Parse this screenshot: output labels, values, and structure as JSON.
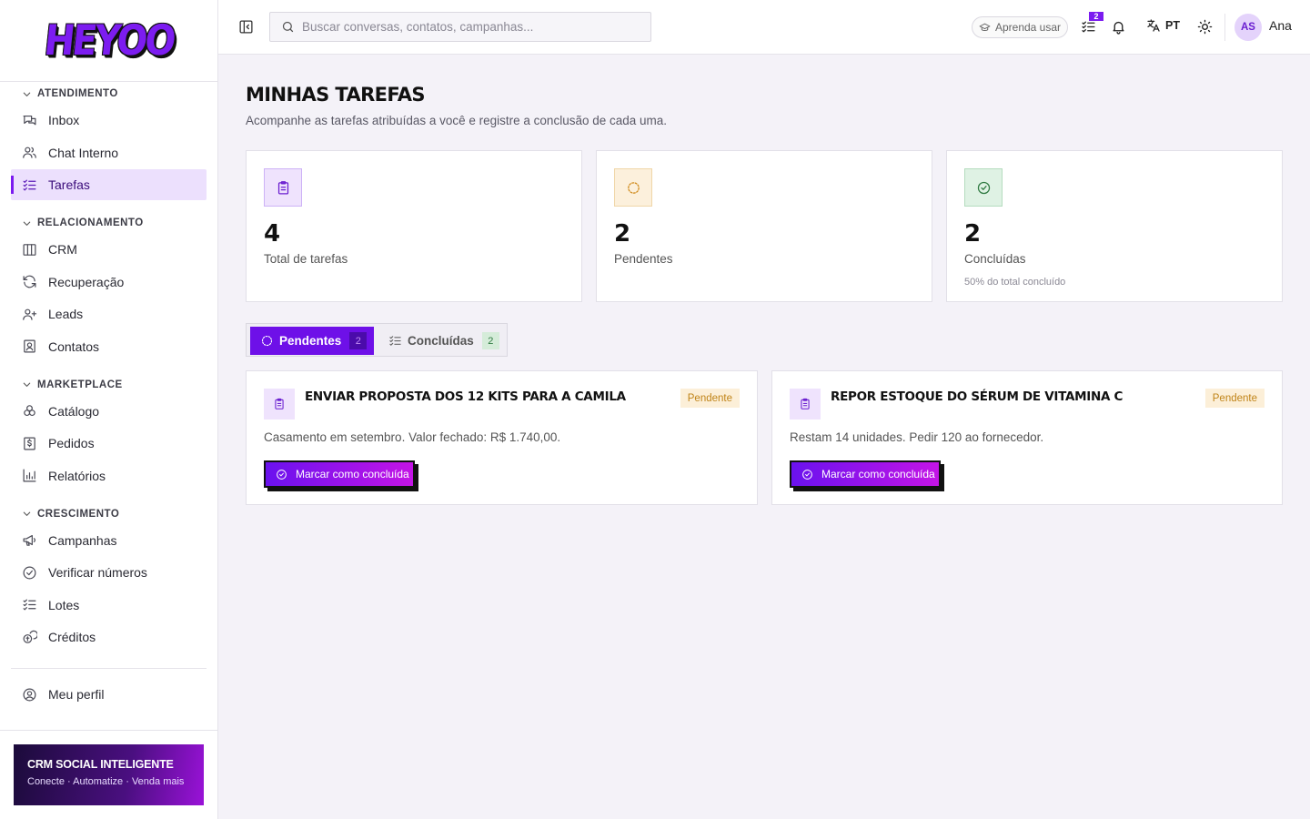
{
  "app": {
    "logo_text": "HEYOO",
    "colors": {
      "accent": "#6e10e8",
      "accent_soft": "#ece0fd",
      "pending": "#c08418",
      "done": "#2f7a41"
    }
  },
  "sidebar": {
    "sections": [
      {
        "title": "ATENDIMENTO",
        "items": [
          {
            "label": "Inbox",
            "icon": "inbox-icon"
          },
          {
            "label": "Chat Interno",
            "icon": "users-icon"
          },
          {
            "label": "Tarefas",
            "icon": "list-check-icon",
            "active": true
          }
        ]
      },
      {
        "title": "RELACIONAMENTO",
        "items": [
          {
            "label": "CRM",
            "icon": "columns-icon"
          },
          {
            "label": "Recuperação",
            "icon": "refresh-icon"
          },
          {
            "label": "Leads",
            "icon": "user-plus-icon"
          },
          {
            "label": "Contatos",
            "icon": "contact-icon"
          }
        ]
      },
      {
        "title": "MARKETPLACE",
        "items": [
          {
            "label": "Catálogo",
            "icon": "boxes-icon"
          },
          {
            "label": "Pedidos",
            "icon": "receipt-icon"
          },
          {
            "label": "Relatórios",
            "icon": "bar-chart-icon"
          }
        ]
      },
      {
        "title": "CRESCIMENTO",
        "items": [
          {
            "label": "Campanhas",
            "icon": "megaphone-icon"
          },
          {
            "label": "Verificar números",
            "icon": "check-circle-icon"
          },
          {
            "label": "Lotes",
            "icon": "list-check-icon"
          },
          {
            "label": "Créditos",
            "icon": "coins-icon"
          }
        ]
      }
    ],
    "profile_label": "Meu perfil",
    "promo": {
      "title": "CRM SOCIAL INTELIGENTE",
      "subtitle": "Conecte · Automatize · Venda mais"
    }
  },
  "topbar": {
    "search_placeholder": "Buscar conversas, contatos, campanhas...",
    "learn_label": "Aprenda usar",
    "tasks_badge": "2",
    "language": "PT",
    "avatar_initials": "AS",
    "user_name": "Ana"
  },
  "page": {
    "title": "MINHAS TAREFAS",
    "subtitle": "Acompanhe as tarefas atribuídas a você e registre a conclusão de cada uma."
  },
  "stats": [
    {
      "value": "4",
      "label": "Total de tarefas",
      "note": ""
    },
    {
      "value": "2",
      "label": "Pendentes",
      "note": ""
    },
    {
      "value": "2",
      "label": "Concluídas",
      "note": "50% do total concluído"
    }
  ],
  "tabs": [
    {
      "label": "Pendentes",
      "count": "2",
      "active": true
    },
    {
      "label": "Concluídas",
      "count": "2",
      "active": false
    }
  ],
  "tasks": [
    {
      "title": "ENVIAR PROPOSTA DOS 12 KITS PARA A CAMILA",
      "status": "Pendente",
      "description": "Casamento em setembro. Valor fechado: R$ 1.740,00.",
      "action": "Marcar como concluída"
    },
    {
      "title": "REPOR ESTOQUE DO SÉRUM DE VITAMINA C",
      "status": "Pendente",
      "description": "Restam 14 unidades. Pedir 120 ao fornecedor.",
      "action": "Marcar como concluída"
    }
  ]
}
